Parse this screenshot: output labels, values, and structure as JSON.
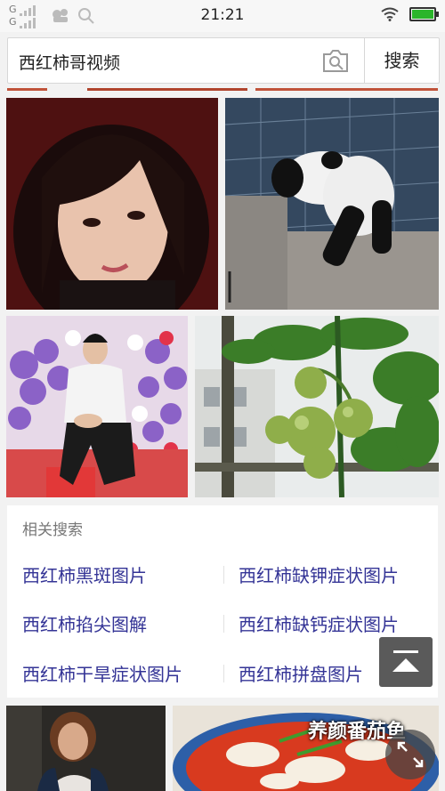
{
  "status_bar": {
    "carrier_top": "G",
    "carrier_bottom": "G",
    "time": "21:21"
  },
  "search": {
    "query": "西红柿哥视频",
    "button_label": "搜索",
    "camera_icon": "camera-search-icon"
  },
  "related": {
    "title": "相关搜索",
    "items": [
      "西红柿黑斑图片",
      "西红柿缺钾症状图片",
      "西红柿掐尖图解",
      "西红柿缺钙症状图片",
      "西红柿干旱症状图片",
      "西红柿拼盘图片"
    ]
  },
  "banner": {
    "text": "养颜番茄鱼"
  },
  "colors": {
    "link": "#343496",
    "stripe": "#c0533a"
  }
}
